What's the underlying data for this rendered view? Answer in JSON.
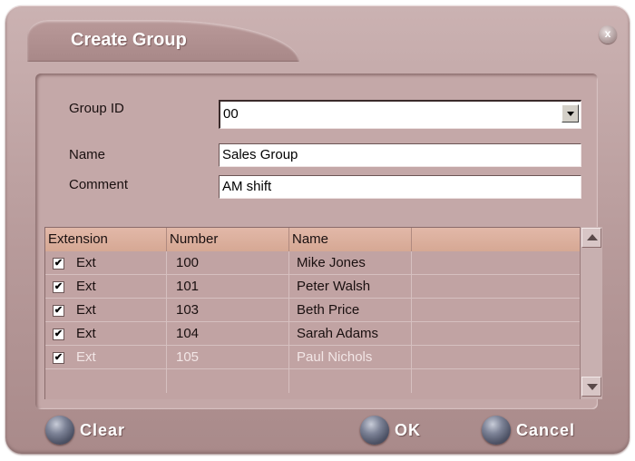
{
  "dialog": {
    "title": "Create Group",
    "close_label": "x"
  },
  "form": {
    "group_id_label": "Group ID",
    "group_id_value": "00",
    "name_label": "Name",
    "name_value": "Sales Group",
    "comment_label": "Comment",
    "comment_value": "AM shift"
  },
  "table": {
    "headers": [
      "Extension",
      "Number",
      "Name",
      ""
    ],
    "rows": [
      {
        "checked": true,
        "type": "Ext",
        "number": "100",
        "name": "Mike Jones"
      },
      {
        "checked": true,
        "type": "Ext",
        "number": "101",
        "name": "Peter Walsh"
      },
      {
        "checked": true,
        "type": "Ext",
        "number": "103",
        "name": "Beth Price"
      },
      {
        "checked": true,
        "type": "Ext",
        "number": "104",
        "name": "Sarah Adams"
      },
      {
        "checked": true,
        "type": "Ext",
        "number": "105",
        "name": "Paul Nichols"
      }
    ]
  },
  "buttons": {
    "clear": "Clear",
    "ok": "OK",
    "cancel": "Cancel"
  },
  "colors": {
    "window_bg": "#b99c9c",
    "header_bg": "#dcae9c",
    "orb": "#5c6275"
  }
}
